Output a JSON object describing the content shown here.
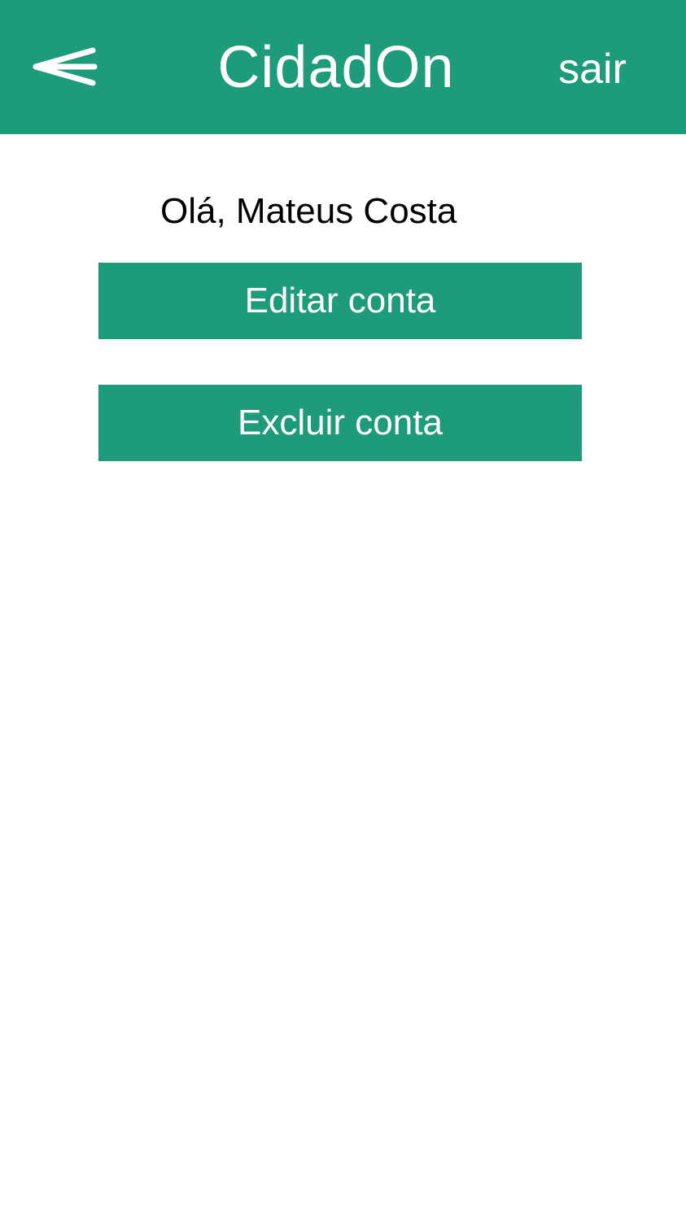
{
  "header": {
    "back_icon": "back-arrow-icon",
    "title": "CidadOn",
    "logout_label": "sair"
  },
  "main": {
    "greeting": "Olá, Mateus Costa",
    "edit_account_label": "Editar conta",
    "delete_account_label": "Excluir conta"
  },
  "colors": {
    "primary": "#1e9b7b",
    "background": "#ffffff",
    "text_on_primary": "#ffffff",
    "text": "#000000"
  }
}
